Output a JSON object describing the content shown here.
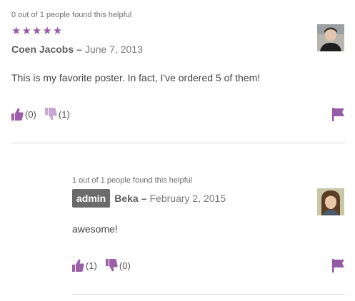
{
  "colors": {
    "accent": "#955ba5",
    "thumb": "#9a5fa8",
    "badge_bg": "#6b6b6b"
  },
  "reviews": [
    {
      "helpful_text": "0 out of 1 people found this helpful",
      "stars": "★★★★★",
      "author": "Coen Jacobs",
      "dash": "–",
      "date": "June 7, 2013",
      "text": "This is my favorite poster. In fact, I've ordered 5 of them!",
      "upvotes": "(0)",
      "downvotes": "(1)",
      "icons": {
        "up": "thumbs-up-icon",
        "down": "thumbs-down-icon",
        "flag": "flag-icon"
      }
    },
    {
      "helpful_text": "1 out of 1 people found this helpful",
      "badge": "admin",
      "author": "Beka",
      "dash": "–",
      "date": "February 2, 2015",
      "text": "awesome!",
      "upvotes": "(1)",
      "downvotes": "(0)",
      "icons": {
        "up": "thumbs-up-icon",
        "down": "thumbs-down-icon",
        "flag": "flag-icon"
      }
    }
  ]
}
